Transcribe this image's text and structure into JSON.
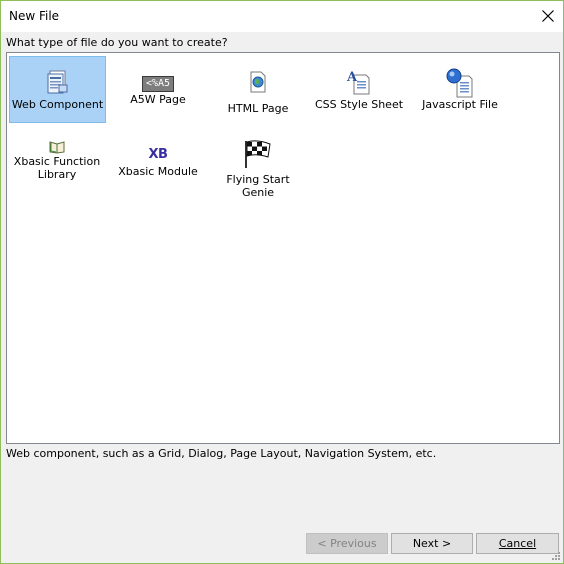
{
  "window": {
    "title": "New File"
  },
  "prompt": "What type of file do you want to create?",
  "items": [
    {
      "label": "Web Component",
      "icon": "web-component-icon"
    },
    {
      "label": "A5W Page",
      "icon": "a5w-page-icon",
      "icon_text": "<%A5"
    },
    {
      "label": "HTML Page",
      "icon": "html-page-icon"
    },
    {
      "label": "CSS Style Sheet",
      "icon": "css-style-sheet-icon"
    },
    {
      "label": "Javascript File",
      "icon": "javascript-file-icon"
    },
    {
      "label": "Xbasic Function\nLibrary",
      "icon": "book-icon"
    },
    {
      "label": "Xbasic Module",
      "icon": "xbasic-module-icon",
      "icon_text": "XB"
    },
    {
      "label": "Flying Start Genie",
      "icon": "checkered-flag-icon"
    }
  ],
  "selected_item": "Web Component",
  "description": "Web component, such as a Grid, Dialog, Page Layout, Navigation System, etc.",
  "buttons": {
    "previous": "< Previous",
    "next": "Next >",
    "cancel": "Cancel"
  },
  "colors": {
    "selection": "#a9d2f6",
    "window_border": "#8fbf5a"
  }
}
